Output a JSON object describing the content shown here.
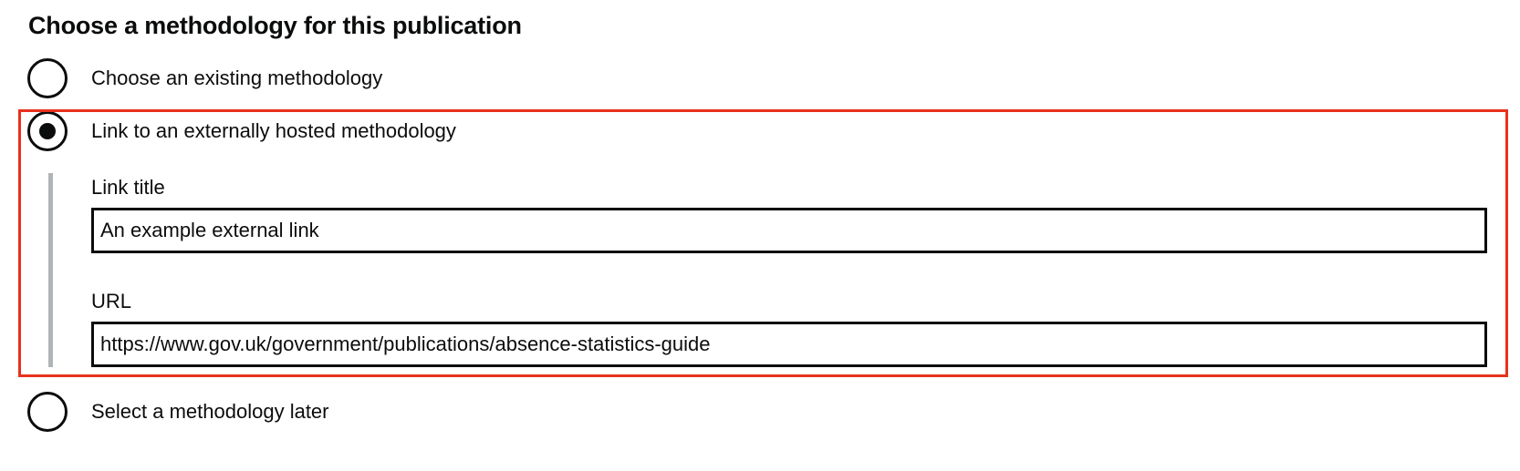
{
  "form": {
    "legend": "Choose a methodology for this publication",
    "options": [
      {
        "label": "Choose an existing methodology",
        "checked": false
      },
      {
        "label": "Link to an externally hosted methodology",
        "checked": true
      },
      {
        "label": "Select a methodology later",
        "checked": false
      }
    ],
    "external_link": {
      "title_label": "Link title",
      "title_value": "An example external link",
      "url_label": "URL",
      "url_value": "https://www.gov.uk/government/publications/absence-statistics-guide"
    }
  },
  "colors": {
    "highlight_border": "#e8311c",
    "text": "#0b0c0c",
    "conditional_bar": "#b1b4b6"
  }
}
